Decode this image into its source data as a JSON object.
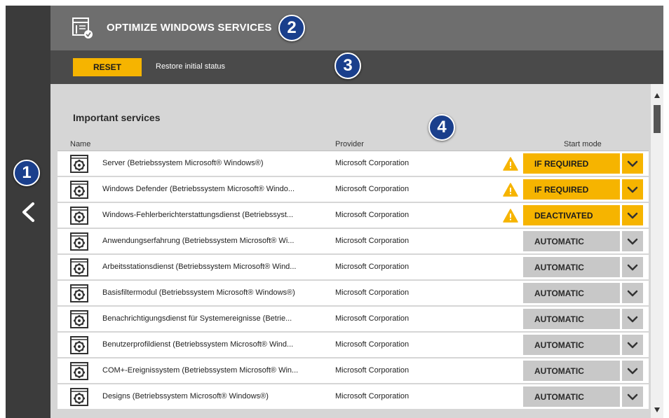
{
  "header": {
    "title": "OPTIMIZE WINDOWS SERVICES",
    "icon": "services-settings-icon"
  },
  "toolbar": {
    "reset_label": "RESET",
    "restore_text": "Restore initial status"
  },
  "badges": [
    "1",
    "2",
    "3",
    "4"
  ],
  "section": {
    "title": "Important services"
  },
  "columns": {
    "name": "Name",
    "provider": "Provider",
    "start_mode": "Start mode"
  },
  "colors": {
    "accent": "#f6b400",
    "header_bg": "#6e6e6e",
    "toolbar_bg": "#4a4a4a",
    "sidebar_bg": "#3b3b3b",
    "badge": "#1a3f8c",
    "mode_gray": "#c8c8c8"
  },
  "services": [
    {
      "name": "Server (Betriebssystem Microsoft® Windows®)",
      "provider": "Microsoft Corporation",
      "warning": true,
      "mode": "IF REQUIRED"
    },
    {
      "name": "Windows Defender (Betriebssystem Microsoft® Windo...",
      "provider": "Microsoft Corporation",
      "warning": true,
      "mode": "IF REQUIRED"
    },
    {
      "name": "Windows-Fehlerberichterstattungsdienst (Betriebssyst...",
      "provider": "Microsoft Corporation",
      "warning": true,
      "mode": "DEACTIVATED"
    },
    {
      "name": "Anwendungserfahrung (Betriebssystem Microsoft® Wi...",
      "provider": "Microsoft Corporation",
      "warning": false,
      "mode": "AUTOMATIC"
    },
    {
      "name": "Arbeitsstationsdienst (Betriebssystem Microsoft® Wind...",
      "provider": "Microsoft Corporation",
      "warning": false,
      "mode": "AUTOMATIC"
    },
    {
      "name": "Basisfiltermodul (Betriebssystem Microsoft® Windows®)",
      "provider": "Microsoft Corporation",
      "warning": false,
      "mode": "AUTOMATIC"
    },
    {
      "name": "Benachrichtigungsdienst für Systemereignisse (Betrie...",
      "provider": "Microsoft Corporation",
      "warning": false,
      "mode": "AUTOMATIC"
    },
    {
      "name": "Benutzerprofildienst (Betriebssystem Microsoft® Wind...",
      "provider": "Microsoft Corporation",
      "warning": false,
      "mode": "AUTOMATIC"
    },
    {
      "name": "COM+-Ereignissystem (Betriebssystem Microsoft® Win...",
      "provider": "Microsoft Corporation",
      "warning": false,
      "mode": "AUTOMATIC"
    },
    {
      "name": "Designs (Betriebssystem Microsoft® Windows®)",
      "provider": "Microsoft Corporation",
      "warning": false,
      "mode": "AUTOMATIC"
    }
  ]
}
